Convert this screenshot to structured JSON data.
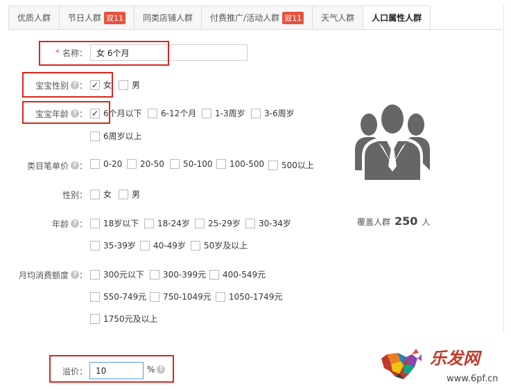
{
  "tabs": [
    {
      "label": "优质人群",
      "badge": null
    },
    {
      "label": "节日人群",
      "badge": "双11"
    },
    {
      "label": "同类店铺人群",
      "badge": null
    },
    {
      "label": "付费推广/活动人群",
      "badge": "双11"
    },
    {
      "label": "天气人群",
      "badge": null
    },
    {
      "label": "人口属性人群",
      "badge": null,
      "active": true
    }
  ],
  "name_field": {
    "label": "名称：",
    "required_mark": "*",
    "value": "女 6个月"
  },
  "baby_gender": {
    "label": "宝宝性别",
    "options": [
      {
        "label": "女",
        "checked": true
      },
      {
        "label": "男",
        "checked": false
      }
    ]
  },
  "baby_age": {
    "label": "宝宝年龄",
    "options": [
      {
        "label": "6个月以下",
        "checked": true
      },
      {
        "label": "6-12个月",
        "checked": false
      },
      {
        "label": "1-3周岁",
        "checked": false
      },
      {
        "label": "3-6周岁",
        "checked": false
      },
      {
        "label": "6周岁以上",
        "checked": false
      }
    ]
  },
  "unit_price": {
    "label": "类目笔单价",
    "options": [
      {
        "label": "0-20"
      },
      {
        "label": "20-50"
      },
      {
        "label": "50-100"
      },
      {
        "label": "100-500"
      },
      {
        "label": "500以上"
      }
    ]
  },
  "gender": {
    "label": "性别：",
    "options": [
      {
        "label": "女"
      },
      {
        "label": "男"
      }
    ]
  },
  "age": {
    "label": "年龄",
    "options": [
      {
        "label": "18岁以下"
      },
      {
        "label": "18-24岁"
      },
      {
        "label": "25-29岁"
      },
      {
        "label": "30-34岁"
      },
      {
        "label": "35-39岁"
      },
      {
        "label": "40-49岁"
      },
      {
        "label": "50岁及以上"
      }
    ]
  },
  "spend": {
    "label": "月均消费额度",
    "options": [
      {
        "label": "300元以下"
      },
      {
        "label": "300-399元"
      },
      {
        "label": "400-549元"
      },
      {
        "label": "550-749元"
      },
      {
        "label": "750-1049元"
      },
      {
        "label": "1050-1749元"
      },
      {
        "label": "1750元及以上"
      }
    ]
  },
  "premium": {
    "label": "溢价：",
    "value": "10",
    "unit": "%"
  },
  "coverage": {
    "prefix": "覆盖人群",
    "count": "250",
    "suffix": "人"
  },
  "help_icon_glyph": "?",
  "colon": "：",
  "check_glyph": "✓",
  "logo": {
    "text": "乐发网",
    "url": "www.6pf.cn"
  },
  "colors": {
    "accent_red": "#d9251c",
    "badge": "#e8523f",
    "icon_gray": "#666666"
  }
}
